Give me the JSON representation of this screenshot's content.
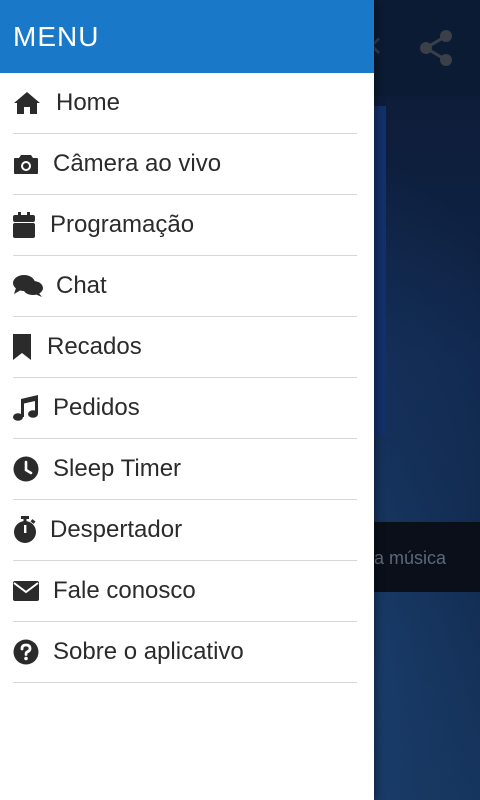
{
  "drawer": {
    "title": "MENU",
    "items": [
      {
        "label": "Home",
        "icon": "home-icon"
      },
      {
        "label": "Câmera ao vivo",
        "icon": "camera-icon"
      },
      {
        "label": "Programação",
        "icon": "calendar-icon"
      },
      {
        "label": "Chat",
        "icon": "chat-icon"
      },
      {
        "label": "Recados",
        "icon": "bookmark-icon"
      },
      {
        "label": "Pedidos",
        "icon": "music-note-icon"
      },
      {
        "label": "Sleep Timer",
        "icon": "clock-icon"
      },
      {
        "label": "Despertador",
        "icon": "stopwatch-icon"
      },
      {
        "label": "Fale conosco",
        "icon": "envelope-icon"
      },
      {
        "label": "Sobre o aplicativo",
        "icon": "help-circle-icon"
      }
    ]
  },
  "background": {
    "now_playing_text": "a música",
    "share_icon": "share-icon",
    "close_icon": "close-icon"
  },
  "colors": {
    "header": "#1a78c8",
    "text": "#2b2b2b",
    "divider": "#d7d7d7"
  }
}
